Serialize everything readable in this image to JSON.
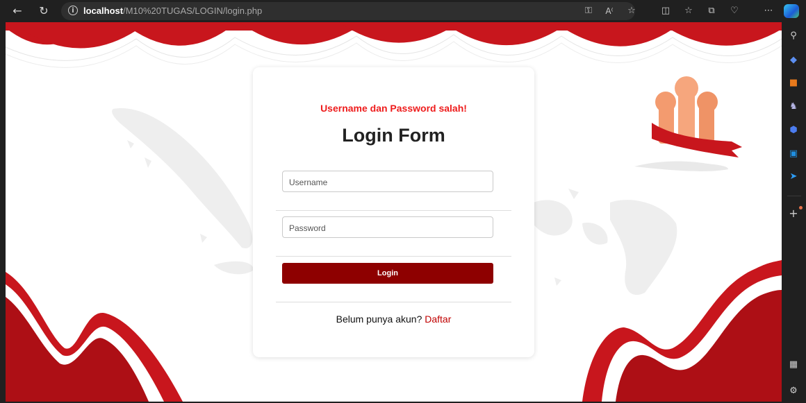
{
  "browser": {
    "url_host": "localhost",
    "url_path": "/M10%20TUGAS/LOGIN/login.php"
  },
  "icons": {
    "back": "back-arrow-icon",
    "refresh": "refresh-icon",
    "info": "info-icon",
    "toolbar": [
      "key-icon",
      "read-aloud-icon",
      "favorite-star-icon",
      "split-screen-icon",
      "favorites-icon",
      "collections-icon",
      "health-icon",
      "more-icon",
      "profile-icon"
    ],
    "sidebar": [
      "search-icon",
      "shopping-tag-icon",
      "tools-icon",
      "games-icon",
      "copilot-icon",
      "outlook-icon",
      "send-icon",
      "add-icon",
      "screenshot-icon",
      "settings-icon"
    ]
  },
  "login": {
    "error": "Username dan Password salah!",
    "title": "Login Form",
    "username_placeholder": "Username",
    "password_placeholder": "Password",
    "button": "Login",
    "footer_text": "Belum punya akun? ",
    "footer_link": "Daftar"
  },
  "colors": {
    "accent_red": "#c8161d",
    "button_red": "#8e0000",
    "error_red": "#ee1c1c",
    "map_gray": "#eeeeee"
  }
}
